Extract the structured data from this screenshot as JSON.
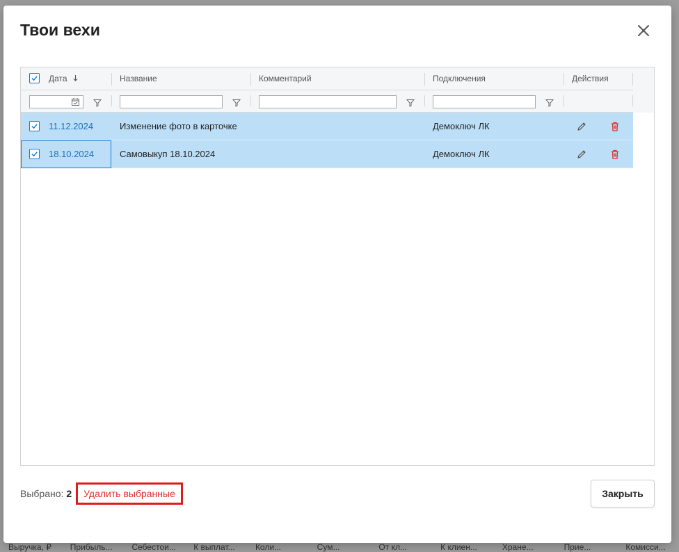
{
  "modal": {
    "title": "Твои вехи",
    "close_icon": "close-icon"
  },
  "grid": {
    "columns": [
      {
        "label": "Дата",
        "sort": "descending"
      },
      {
        "label": "Название"
      },
      {
        "label": "Комментарий"
      },
      {
        "label": "Подключения"
      },
      {
        "label": "Действия"
      }
    ],
    "filters": {
      "date": "",
      "name": "",
      "comment": "",
      "connection": ""
    },
    "rows": [
      {
        "checked": true,
        "date": "11.12.2024",
        "name": "Изменение фото в карточке",
        "comment": "",
        "connection": "Демоключ ЛК"
      },
      {
        "checked": true,
        "date": "18.10.2024",
        "name": "Самовыкуп 18.10.2024",
        "comment": "",
        "connection": "Демоключ ЛК"
      }
    ]
  },
  "footer": {
    "selected_label": "Выбрано:",
    "selected_count": "2",
    "delete_label": "Удалить выбранные",
    "close_label": "Закрыть"
  },
  "background": {
    "columns": [
      "Выручка, ₽",
      "Прибыль...",
      "Себестои...",
      "К выплат...",
      "Коли...",
      "Сум...",
      "От кл...",
      "К клиен...",
      "Хране...",
      "Прие...",
      "Комисси..."
    ]
  },
  "colors": {
    "accent": "#1976d2",
    "row_selected": "#bcdff7",
    "delete_red": "#e01b1b",
    "date_link": "#1d6fb8"
  }
}
